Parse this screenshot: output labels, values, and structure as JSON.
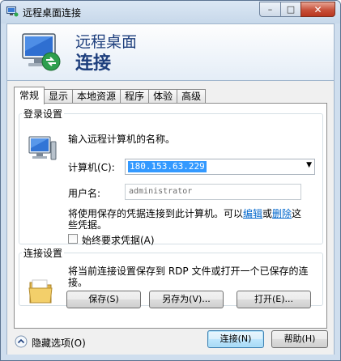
{
  "window": {
    "title": "远程桌面连接",
    "controls": {
      "minimize": "–",
      "maximize": "□",
      "close": "✕"
    }
  },
  "header": {
    "line1": "远程桌面",
    "line2": "连接"
  },
  "tabs": [
    {
      "label": "常规",
      "active": true
    },
    {
      "label": "显示"
    },
    {
      "label": "本地资源"
    },
    {
      "label": "程序"
    },
    {
      "label": "体验"
    },
    {
      "label": "高级"
    }
  ],
  "login_settings": {
    "legend": "登录设置",
    "prompt": "输入远程计算机的名称。",
    "computer_label": "计算机(C):",
    "computer_value": "180.153.63.229",
    "username_label": "用户名:",
    "username_value": "administrator",
    "saved_text_1": "将使用保存的凭据连接到此计算机。可以",
    "edit_link": "编辑",
    "or_text": "或",
    "delete_link": "删除",
    "saved_text_2": "这",
    "saved_text_3": "些凭据。",
    "always_ask_label": "始终要求凭据(A)",
    "always_ask_checked": false
  },
  "connection_settings": {
    "legend": "连接设置",
    "desc_1": "将当前连接设置保存到 RDP 文件或打开一个已保存的连",
    "desc_2": "接。",
    "save_button": "保存(S)",
    "save_as_button": "另存为(V)...",
    "open_button": "打开(E)..."
  },
  "footer": {
    "hide_options": "隐藏选项(O)",
    "connect_button": "连接(N)",
    "help_button": "帮助(H)"
  },
  "colors": {
    "accent": "#1e3f7d",
    "link": "#0066cc",
    "selection": "#3399ff",
    "frame": "#cfdeee"
  },
  "icons": [
    "rdp-app-icon",
    "remote-desktop-icon",
    "computer-icon",
    "folder-icon",
    "chevron-up-icon"
  ]
}
